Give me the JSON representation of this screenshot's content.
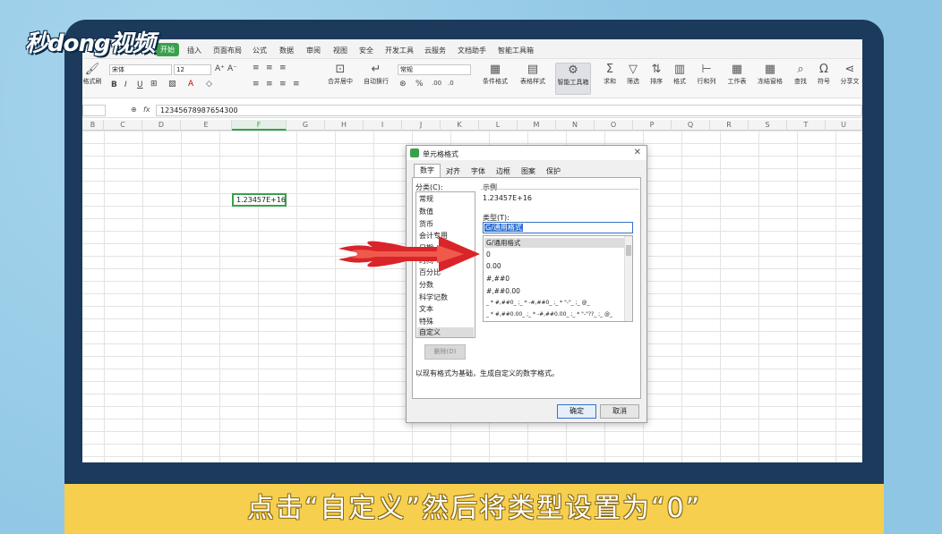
{
  "brand": {
    "logo_text": "秒dong视频"
  },
  "menubar": {
    "tabs": [
      "开始",
      "插入",
      "页面布局",
      "公式",
      "数据",
      "审阅",
      "视图",
      "安全",
      "开发工具",
      "云服务",
      "文档助手",
      "智能工具箱"
    ]
  },
  "ribbon": {
    "format_painter": "格式刷",
    "font_name": "宋体",
    "font_size": "12",
    "number_format": "常规",
    "merge_center": "合并居中",
    "wrap_text": "自动换行",
    "conditional_format": "条件格式",
    "table_style": "表格样式",
    "smart_toolbox": "智能工具箱",
    "sum": "求和",
    "filter": "筛选",
    "sort": "排序",
    "format": "格式",
    "row_col": "行和列",
    "worksheet": "工作表",
    "freeze": "冻结窗格",
    "find": "查找",
    "symbol": "符号",
    "share": "分享文"
  },
  "formula_bar": {
    "fx": "fx",
    "value": "12345678987654300"
  },
  "columns": [
    "B",
    "C",
    "D",
    "E",
    "F",
    "G",
    "H",
    "I",
    "J",
    "K",
    "L",
    "M",
    "N",
    "O",
    "P",
    "Q",
    "R",
    "S",
    "T",
    "U"
  ],
  "selected_column": "F",
  "active_cell": {
    "display": "1.23457E+16"
  },
  "dialog": {
    "title": "单元格格式",
    "close": "✕",
    "tabs": [
      "数字",
      "对齐",
      "字体",
      "边框",
      "图案",
      "保护"
    ],
    "category_label": "分类(C):",
    "categories": [
      "常规",
      "数值",
      "货币",
      "会计专用",
      "日期",
      "时间",
      "百分比",
      "分数",
      "科学记数",
      "文本",
      "特殊",
      "自定义"
    ],
    "selected_category": "自定义",
    "sample_label": "示例",
    "sample_value": "1.23457E+16",
    "type_label": "类型(T):",
    "type_value": "G/通用格式",
    "type_list": [
      "G/通用格式",
      "0",
      "0.00",
      "#,##0",
      "#,##0.00",
      "_ * #,##0_ ;_ * -#,##0_ ;_ * \"-\"_ ;_ @_",
      "_ * #,##0.00_ ;_ * -#,##0.00_ ;_ * \"-\"??_ ;_ @_"
    ],
    "delete_button": "删除(D)",
    "description": "以现有格式为基础，生成自定义的数字格式。",
    "ok_button": "确定",
    "cancel_button": "取消"
  },
  "caption": "点击“自定义”然后将类型设置为“0”",
  "colors": {
    "accent": "#3aa14b",
    "caption_bg": "#f6cf4e",
    "monitor": "#1b3a5c",
    "arrow": "#d9242a"
  }
}
